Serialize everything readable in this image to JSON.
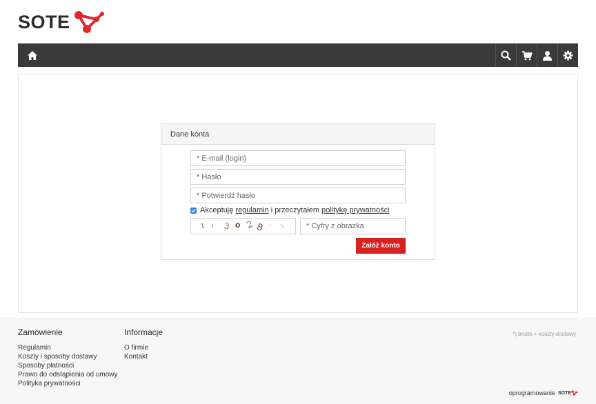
{
  "logo": {
    "text": "SOTE"
  },
  "form": {
    "title": "Dane konta",
    "email_placeholder": "* E-mail (login)",
    "password_placeholder": "* Hasło",
    "confirm_placeholder": "* Potwierdź hasło",
    "terms_prefix": "Akceptuję",
    "terms_link1": "regulamin",
    "terms_middle": "i przeczytałem",
    "terms_link2": "politykę prywatności",
    "terms_checked": true,
    "captcha_chars": [
      "1",
      "\\",
      "3",
      "o",
      "2",
      "8",
      "-",
      "\\"
    ],
    "captcha_placeholder": "* Cyfry z obrazka",
    "submit_label": "Załóż konto"
  },
  "footer": {
    "col1": {
      "title": "Zamówienie",
      "links": [
        "Regulamin",
        "Koszty i sposoby dostawy",
        "Sposoby płatności",
        "Prawo do odstąpienia od umowy",
        "Polityka prywatności"
      ]
    },
    "col2": {
      "title": "Informacje",
      "links": [
        "O firmie",
        "Kontakt"
      ]
    },
    "note": "*) brutto + koszty dostawy",
    "powered_label": "oprogramowanie",
    "powered_brand": "SOTE"
  },
  "colors": {
    "accent": "#d9211d",
    "nav_bg": "#3a3a3a"
  }
}
